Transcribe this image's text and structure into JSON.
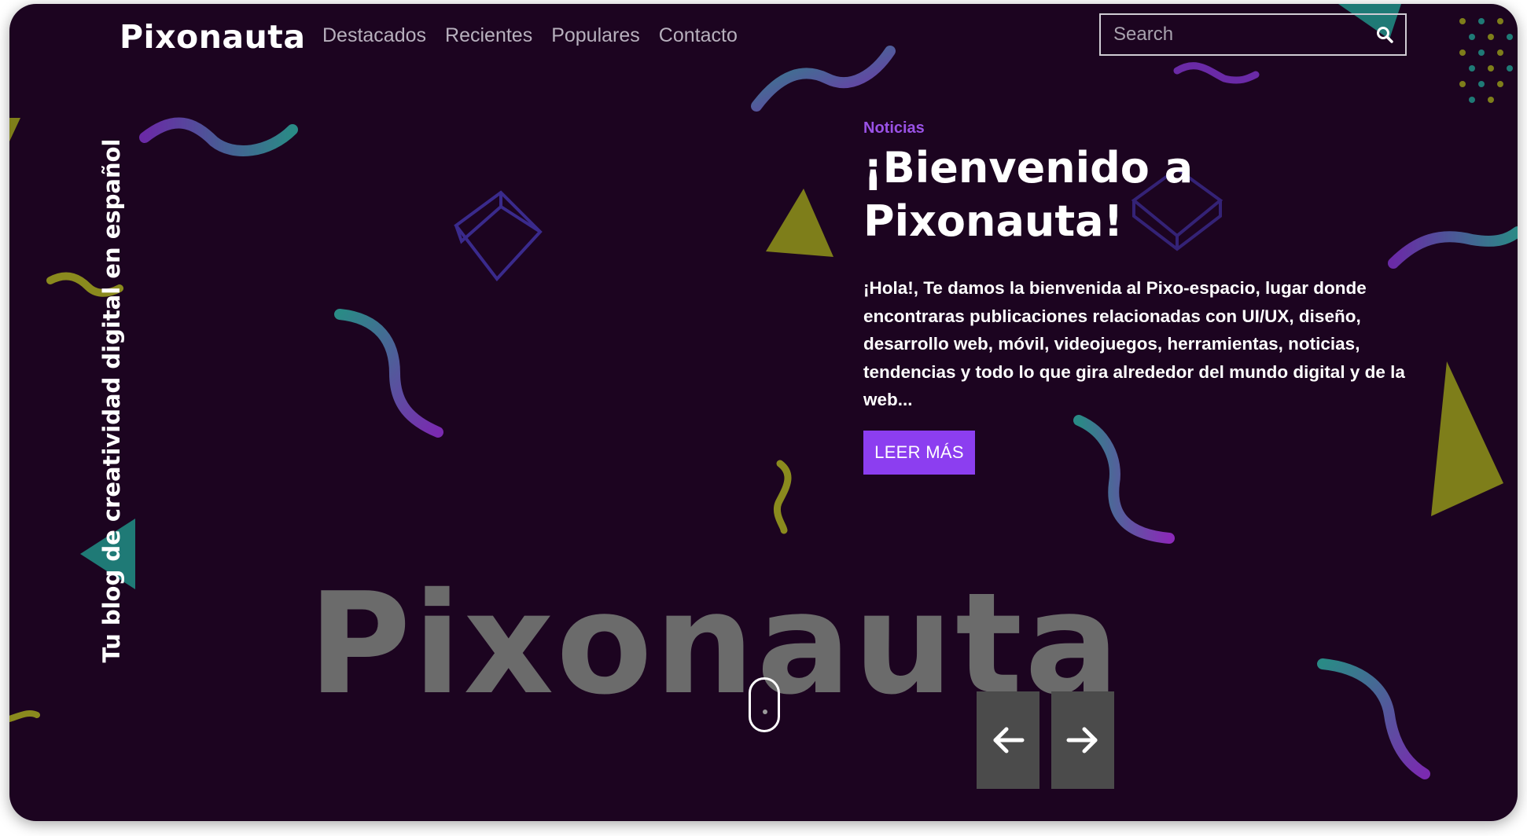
{
  "header": {
    "logo": "Pixonauta",
    "nav": [
      "Destacados",
      "Recientes",
      "Populares",
      "Contacto"
    ],
    "search_placeholder": "Search"
  },
  "sidebar": {
    "tagline": "Tu blog de creatividad digital en español"
  },
  "hero": {
    "category": "Noticias",
    "title": "¡Bienvenido a Pixonauta!",
    "text": "¡Hola!, Te damos la bienvenida al Pixo-espacio, lugar donde encontraras publicaciones relacionadas con UI/UX, diseño, desarrollo web, móvil, videojuegos, herramientas, noticias, tendencias y todo lo que gira alrededor del mundo digital y de la web...",
    "cta": "LEER MÁS",
    "watermark": "Pixonauta"
  },
  "colors": {
    "background": "#1c0420",
    "accent": "#8c3ef0",
    "category": "#9a52e6"
  },
  "icons": [
    "search-icon",
    "mouse-scroll-icon",
    "arrow-left-icon",
    "arrow-right-icon"
  ]
}
